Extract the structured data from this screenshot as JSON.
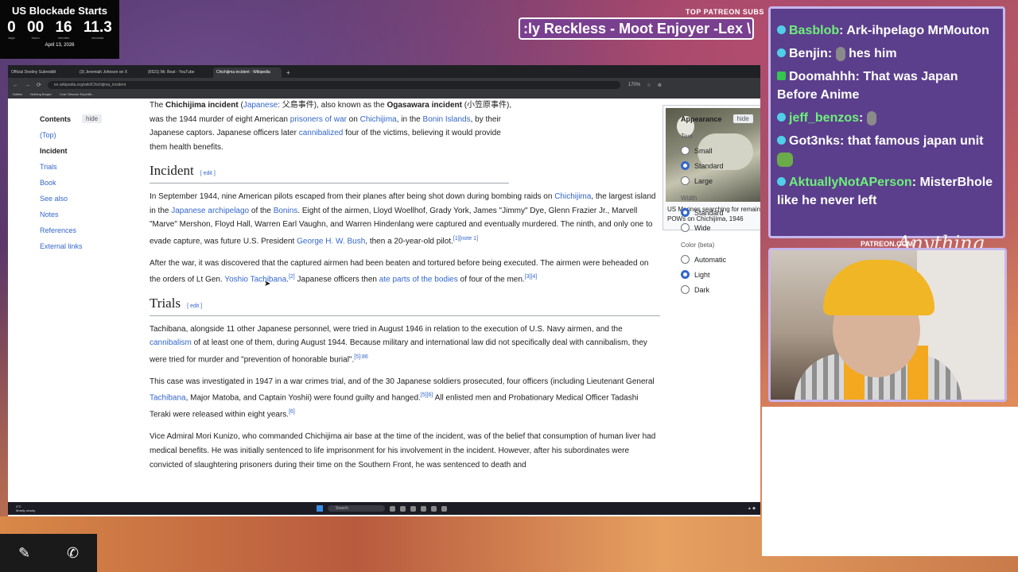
{
  "countdown": {
    "title": "US Blockade Starts",
    "segments": [
      {
        "value": "0",
        "unit": "days"
      },
      {
        "value": "00",
        "unit": "hours"
      },
      {
        "value": "16",
        "unit": "minutes"
      },
      {
        "value": "11.3",
        "unit": "seconds"
      }
    ],
    "date": "April 13, 2026"
  },
  "patreon": {
    "label": "TOP PATREON SUBS",
    "ticker": ":ly Reckless - Moot Enjoyer -Lex \\",
    "url": "PATREON.COM/"
  },
  "chat": {
    "messages": [
      {
        "user": "Basblob",
        "text": "Ark-ihpelago MrMouton"
      },
      {
        "user": "Benjin",
        "text": "hes him"
      },
      {
        "user": "Doomahhh",
        "text": "That was Japan Before Anime"
      },
      {
        "user": "jeff_benzos",
        "text": ""
      },
      {
        "user": "Got3nks",
        "text": "that famous japan unit"
      },
      {
        "user": "AktuallyNotAPerson",
        "text": "MisterBhole like he never left"
      }
    ]
  },
  "browser": {
    "tabs": [
      "Official Destiny Subreddit",
      "(3) Jeremiah Johnson on X",
      "(6521) Mr. Beat - YouTube",
      "Chichijima incident - Wikipedia"
    ],
    "new_tab": "+",
    "url": "en.wikipedia.org/wiki/Chichijima_incident",
    "zoom": "170%",
    "bookmarks": [
      "Dailies",
      "Nothing Burger",
      "Czar Obscure Expediti..."
    ]
  },
  "toc": {
    "title": "Contents",
    "hide": "hide",
    "items": [
      "(Top)",
      "Incident",
      "Trials",
      "Book",
      "See also",
      "Notes",
      "References",
      "External links"
    ]
  },
  "article": {
    "lead": {
      "t1": "The ",
      "b1": "Chichijima incident",
      "t2": " (",
      "l1": "Japanese",
      "t3": ": 父島事件), also known as the ",
      "b2": "Ogasawara incident",
      "t4": " (小笠原事件), was the 1944 murder of eight American ",
      "l2": "prisoners of war",
      "t5": " on ",
      "l3": "Chichijima",
      "t6": ", in the ",
      "l4": "Bonin Islands",
      "t7": ", by their Japanese captors. Japanese officers later ",
      "l5": "cannibalized",
      "t8": " four of the victims, believing it would provide them health benefits."
    },
    "incident": {
      "heading": "Incident",
      "edit": "[ edit ]",
      "p1": {
        "t1": "In September 1944, nine American pilots escaped from their planes after being shot down during bombing raids on ",
        "l1": "Chichijima",
        "t2": ", the largest island in the ",
        "l2": "Japanese archipelago",
        "t3": " of the ",
        "l3": "Bonins",
        "t4": ". Eight of the airmen, Lloyd Woellhof, Grady York, James \"Jimmy\" Dye, Glenn Frazier Jr., Marvell \"Marve\" Mershon, Floyd Hall, Warren Earl Vaughn, and Warren Hindenlang were captured and eventually murdered. The ninth, and only one to evade capture, was future U.S. President ",
        "l4": "George H. W. Bush",
        "t5": ", then a 20-year-old pilot.",
        "s1": "[1][note 1]"
      },
      "p2": {
        "t1": "After the war, it was discovered that the captured airmen had been beaten and tortured before being executed. The airmen were beheaded on the orders of Lt Gen. ",
        "l1": "Yoshio Tachibana",
        "t2": ".",
        "s1": "[2]",
        "t3": " Japanese officers then ",
        "l2": "ate parts of the bodies",
        "t4": " of four of the men.",
        "s2": "[3][4]"
      }
    },
    "trials": {
      "heading": "Trials",
      "edit": "[ edit ]",
      "p1": {
        "t1": "Tachibana, alongside 11 other Japanese personnel, were tried in August 1946 in relation to the execution of U.S. Navy airmen, and the ",
        "l1": "cannibalism",
        "t2": " of at least one of them, during August 1944. Because military and international law did not specifically deal with cannibalism, they were tried for murder and \"prevention of honorable burial\".",
        "s1": "[5]:86"
      },
      "p2": {
        "t1": "This case was investigated in 1947 in a war crimes trial, and of the 30 Japanese soldiers prosecuted, four officers (including Lieutenant General ",
        "l1": "Tachibana",
        "t2": ", Major Matoba, and Captain Yoshii) were found guilty and hanged.",
        "s1": "[5][6]",
        "t3": " All enlisted men and Probationary Medical Officer Tadashi Teraki were released within eight years.",
        "s2": "[6]"
      },
      "p3": {
        "t1": "Vice Admiral Mori Kunizo, who commanded Chichijima air base at the time of the incident, was of the belief that consumption of human liver had medical benefits. He was initially sentenced to life imprisonment for his involvement in the incident. However, after his subordinates were convicted of slaughtering prisoners during their time on the Southern Front, he was sentenced to death and"
      }
    },
    "infobox_caption": "US Marines searching for remains of killed POWs on Chichijima, 1946"
  },
  "appearance": {
    "title": "Appearance",
    "hide": "hide",
    "text_label": "Text",
    "text_options": [
      "Small",
      "Standard",
      "Large"
    ],
    "width_label": "Width",
    "width_options": [
      "Standard",
      "Wide"
    ],
    "color_label": "Color (beta)",
    "color_options": [
      "Automatic",
      "Light",
      "Dark"
    ]
  },
  "taskbar": {
    "weather_temp": "4°C",
    "weather_desc": "Mostly cloudy",
    "search": "Search"
  },
  "colors": {
    "link": "#3366cc",
    "chat_bg": "#5b3f8c",
    "chat_user": "#6ef07a"
  }
}
